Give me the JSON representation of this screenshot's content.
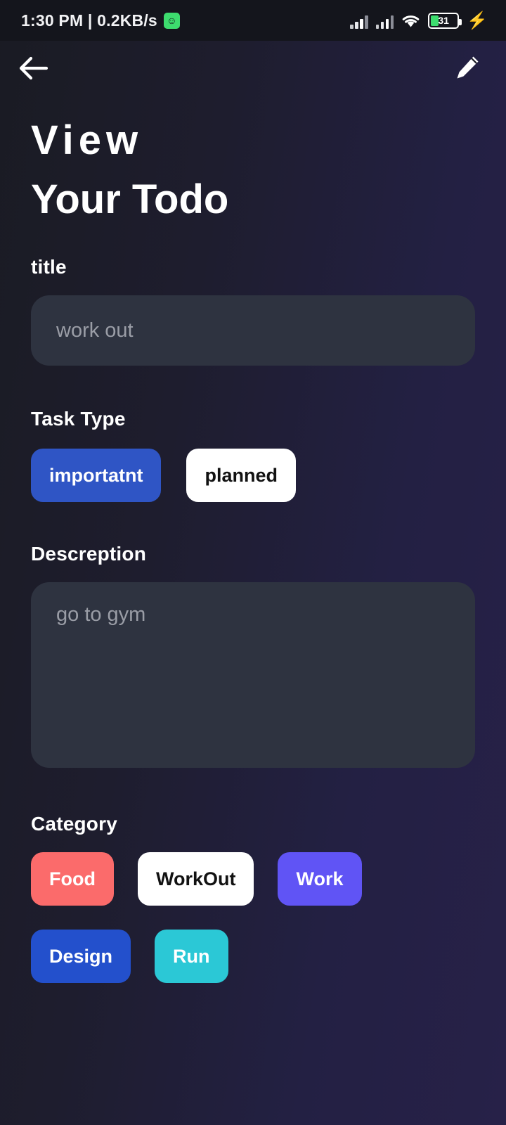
{
  "statusbar": {
    "time_and_speed": "1:30 PM | 0.2KB/s",
    "android_icon": "android-robot-icon",
    "signal_icon_1": "cellular-signal-icon",
    "signal_icon_2": "cellular-signal-icon",
    "wifi_icon": "wifi-icon",
    "battery_level": "31",
    "charging_icon": "lightning-bolt-icon"
  },
  "topnav": {
    "back_icon": "back-arrow-icon",
    "edit_icon": "pencil-edit-icon"
  },
  "header": {
    "line1": "View",
    "line2": "Your Todo"
  },
  "title_field": {
    "label": "title",
    "placeholder": "work out",
    "value": ""
  },
  "task_type": {
    "label": "Task Type",
    "options": [
      {
        "label": "importatnt",
        "bg": "#2f55c5",
        "fg": "#ffffff",
        "selected": true
      },
      {
        "label": "planned",
        "bg": "#ffffff",
        "fg": "#121212",
        "selected": false
      }
    ]
  },
  "description_field": {
    "label": "Descreption",
    "placeholder": "go to gym",
    "value": ""
  },
  "category": {
    "label": "Category",
    "options": [
      {
        "label": "Food",
        "bg": "#fb6b6b",
        "fg": "#ffffff"
      },
      {
        "label": "WorkOut",
        "bg": "#ffffff",
        "fg": "#121212"
      },
      {
        "label": "Work",
        "bg": "#6054f5",
        "fg": "#ffffff"
      },
      {
        "label": "Design",
        "bg": "#2350cc",
        "fg": "#ffffff"
      },
      {
        "label": "Run",
        "bg": "#2bc8d6",
        "fg": "#ffffff"
      }
    ]
  },
  "theme": {
    "bg_left": "#1a1b23",
    "bg_right": "#272148",
    "field_bg": "#2e3340",
    "placeholder": "#9a9da6",
    "accent_blue": "#2f55c5",
    "statusbar_bg": "#14151c"
  }
}
